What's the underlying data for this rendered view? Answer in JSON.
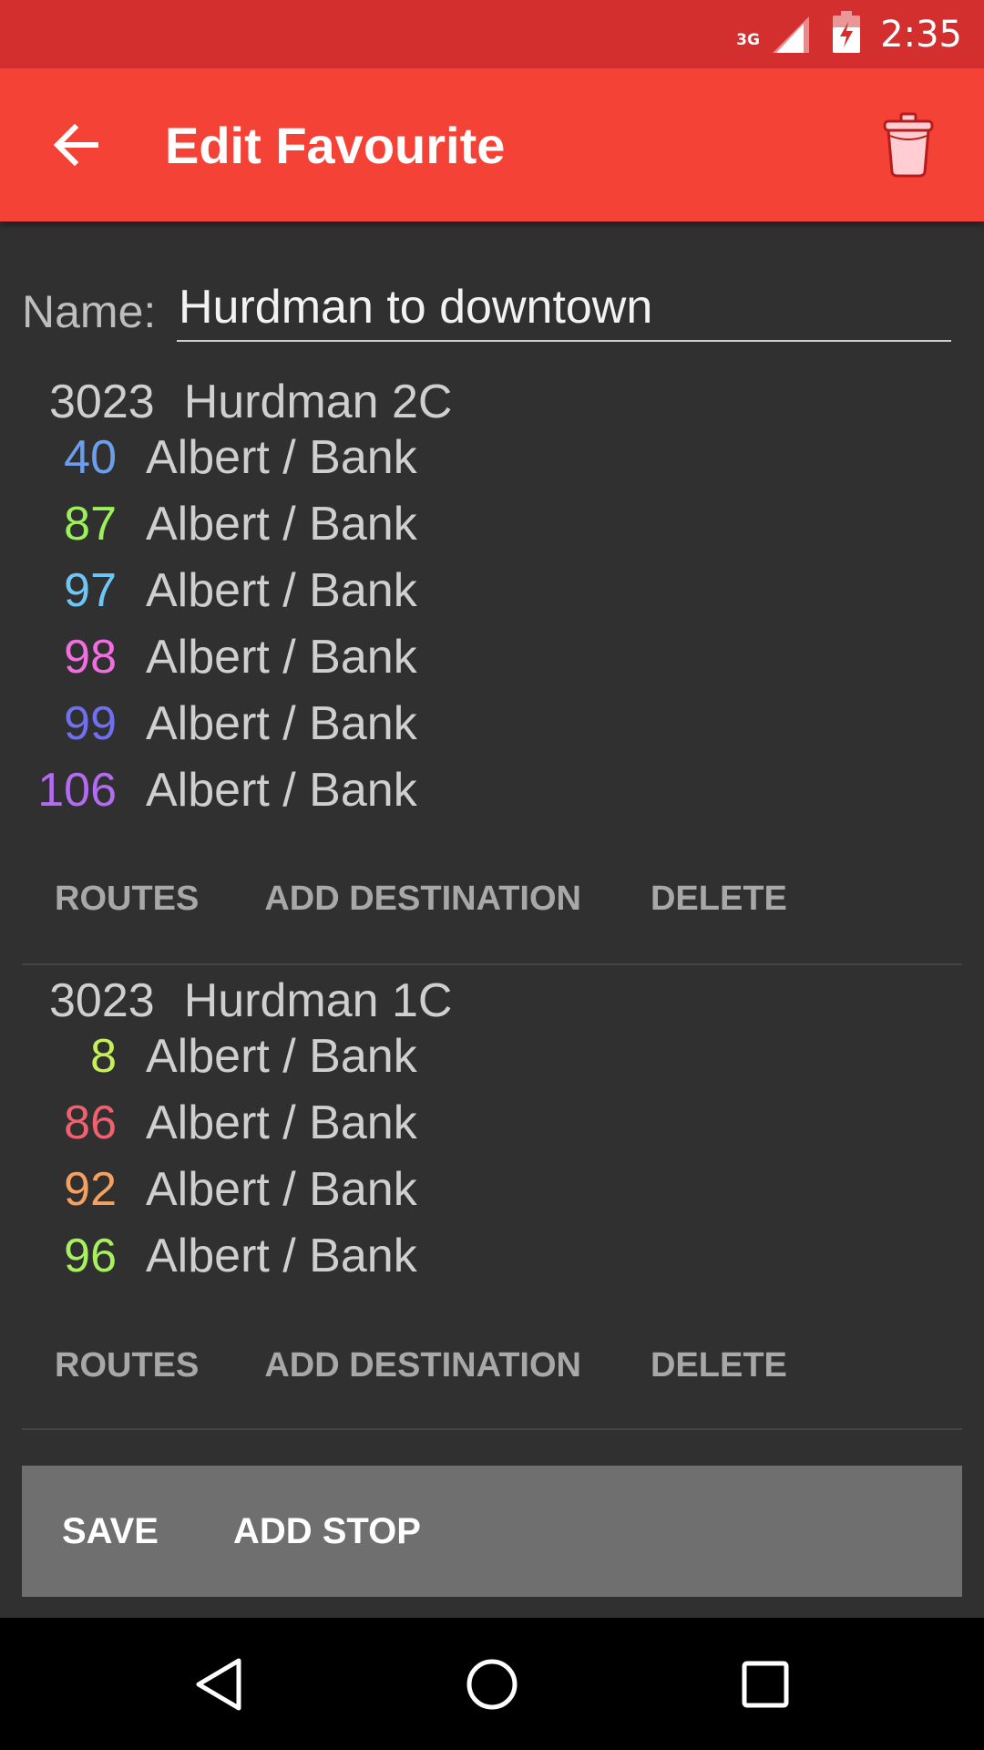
{
  "status_bar": {
    "network_type": "3G",
    "time": "2:35"
  },
  "app_bar": {
    "title": "Edit Favourite",
    "back_icon": "arrow-back-icon",
    "action_icon": "trash-icon"
  },
  "name_field": {
    "label": "Name:",
    "value": "Hurdman to downtown"
  },
  "stops": [
    {
      "stop_number": "3023",
      "stop_name": "Hurdman 2C",
      "destinations": [
        {
          "route": "40",
          "name": "Albert / Bank",
          "color": "#6d9eeb"
        },
        {
          "route": "87",
          "name": "Albert / Bank",
          "color": "#9cf05a"
        },
        {
          "route": "97",
          "name": "Albert / Bank",
          "color": "#6ec6f5"
        },
        {
          "route": "98",
          "name": "Albert / Bank",
          "color": "#f06ee0"
        },
        {
          "route": "99",
          "name": "Albert / Bank",
          "color": "#6f6ff0"
        },
        {
          "route": "106",
          "name": "Albert / Bank",
          "color": "#b26cf0"
        }
      ],
      "actions": {
        "routes": "ROUTES",
        "add_destination": "ADD DESTINATION",
        "delete": "DELETE"
      }
    },
    {
      "stop_number": "3023",
      "stop_name": "Hurdman 1C",
      "destinations": [
        {
          "route": "8",
          "name": "Albert / Bank",
          "color": "#c6f05a"
        },
        {
          "route": "86",
          "name": "Albert / Bank",
          "color": "#f0606e"
        },
        {
          "route": "92",
          "name": "Albert / Bank",
          "color": "#f5a060"
        },
        {
          "route": "96",
          "name": "Albert / Bank",
          "color": "#a9f060"
        }
      ],
      "actions": {
        "routes": "ROUTES",
        "add_destination": "ADD DESTINATION",
        "delete": "DELETE"
      }
    }
  ],
  "bottom_actions": {
    "save": "SAVE",
    "add_stop": "ADD STOP"
  },
  "nav_bar": {
    "back": "nav-back-icon",
    "home": "nav-home-icon",
    "recents": "nav-recents-icon"
  },
  "colors": {
    "status_bar": "#d32f2f",
    "app_bar": "#f44336",
    "background": "#303030",
    "bottom_bar": "#6f6f6f"
  }
}
